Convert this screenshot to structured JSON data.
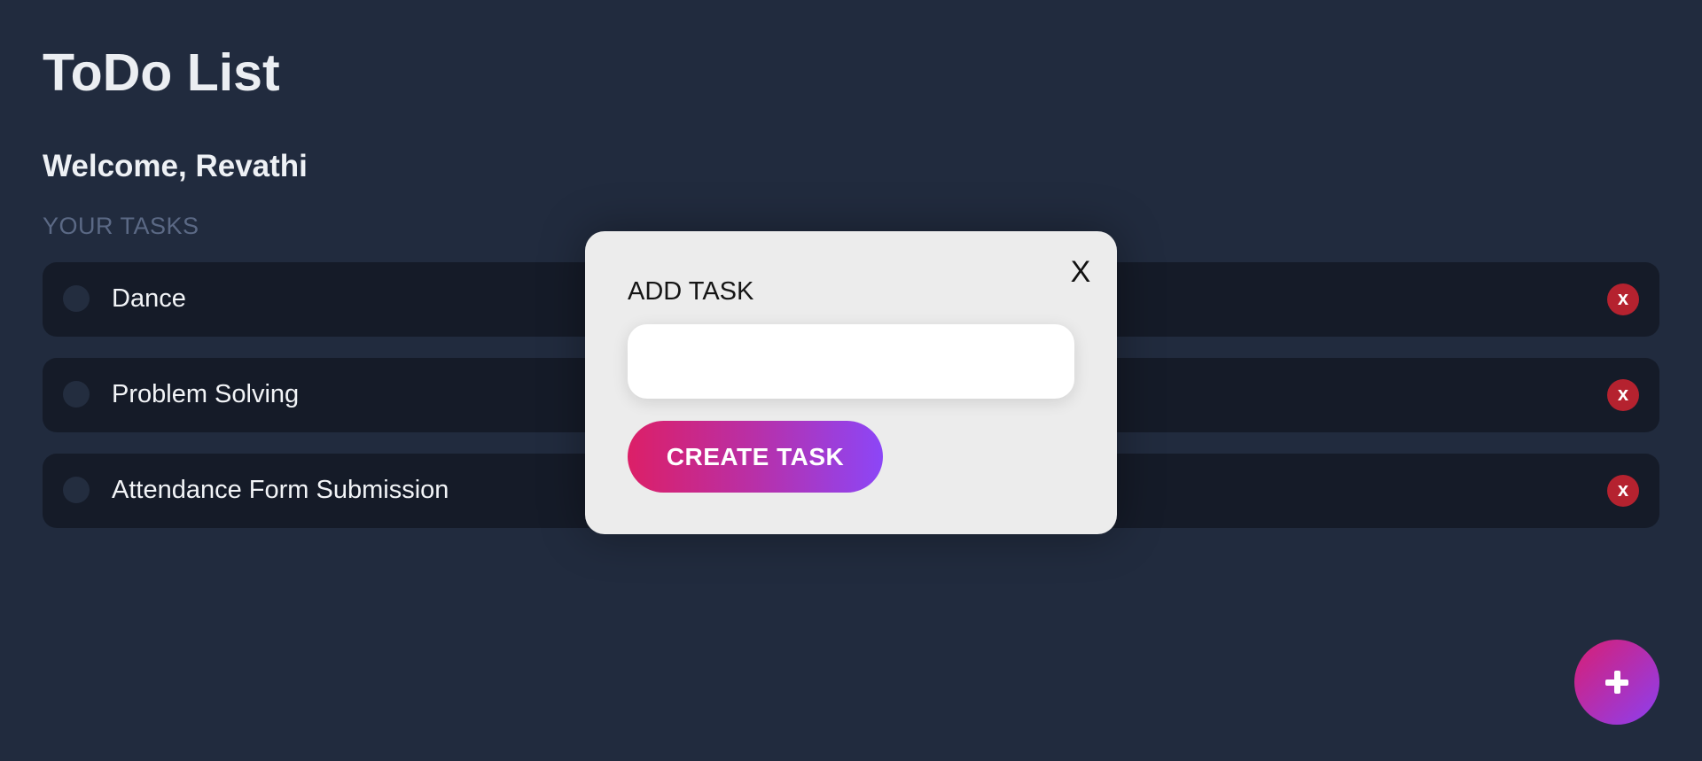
{
  "header": {
    "title": "ToDo List",
    "welcome": "Welcome, Revathi"
  },
  "tasks_section": {
    "label": "YOUR TASKS",
    "items": [
      {
        "text": "Dance",
        "delete_label": "x",
        "completed": false
      },
      {
        "text": "Problem Solving",
        "delete_label": "x",
        "completed": false
      },
      {
        "text": "Attendance Form Submission",
        "delete_label": "x",
        "completed": false
      }
    ]
  },
  "fab": {
    "icon": "plus-icon"
  },
  "modal": {
    "close_label": "X",
    "title": "ADD TASK",
    "input_value": "",
    "input_placeholder": "",
    "submit_label": "CREATE TASK"
  },
  "colors": {
    "background": "#212b3e",
    "task_card": "#151b28",
    "delete_red": "#b5222f",
    "gradient_start": "#dc1f67",
    "gradient_end": "#8c46f7",
    "modal_background": "#ececec"
  }
}
